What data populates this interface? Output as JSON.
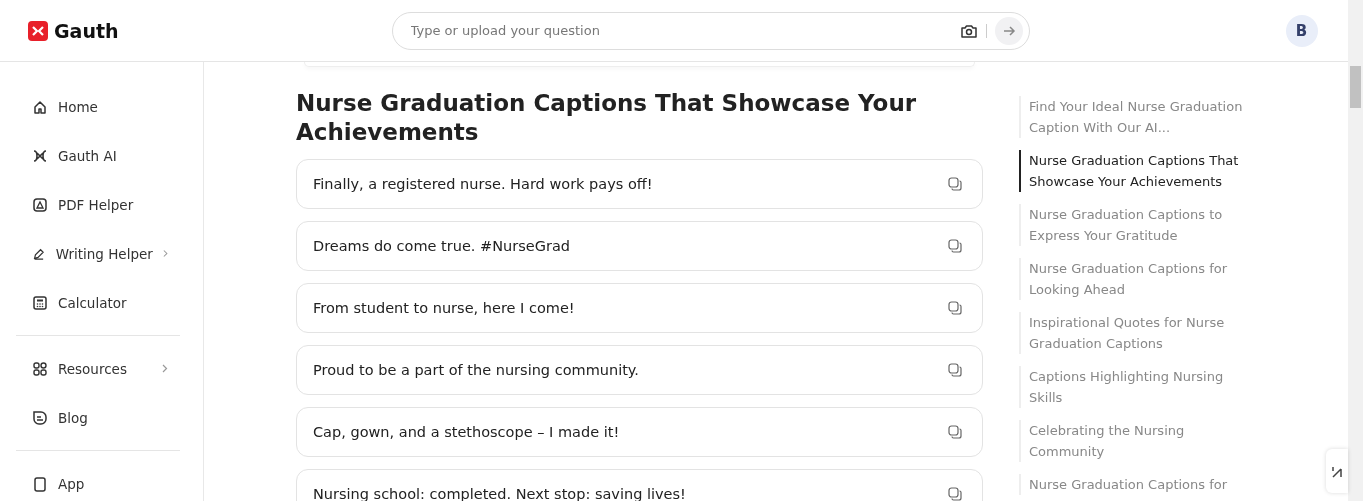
{
  "header": {
    "logo": "Gauth",
    "search": {
      "placeholder": "Type or upload your question"
    },
    "avatar": "B"
  },
  "sidebar": {
    "groups": [
      {
        "items": [
          {
            "label": "Home",
            "kind": "home",
            "submenu": false
          },
          {
            "label": "Gauth AI",
            "kind": "ai",
            "submenu": false
          },
          {
            "label": "PDF Helper",
            "kind": "pdf",
            "submenu": false
          },
          {
            "label": "Writing Helper",
            "kind": "pen",
            "submenu": true
          },
          {
            "label": "Calculator",
            "kind": "calc",
            "submenu": false
          }
        ]
      },
      {
        "items": [
          {
            "label": "Resources",
            "kind": "grid",
            "submenu": true
          },
          {
            "label": "Blog",
            "kind": "blog",
            "submenu": false
          }
        ]
      },
      {
        "items": [
          {
            "label": "App",
            "kind": "app",
            "submenu": false
          }
        ]
      }
    ]
  },
  "article": {
    "heading": "Nurse Graduation Captions That Showcase Your Achievements",
    "captions": [
      "Finally, a registered nurse. Hard work pays off!",
      "Dreams do come true. #NurseGrad",
      "From student to nurse, here I come!",
      "Proud to be a part of the nursing community.",
      "Cap, gown, and a stethoscope – I made it!",
      "Nursing school: completed. Next stop: saving lives!"
    ]
  },
  "toc": [
    {
      "label": "Find Your Ideal Nurse Graduation Caption With Our AI...",
      "selected": false
    },
    {
      "label": "Nurse Graduation Captions That Showcase Your Achievements",
      "selected": true
    },
    {
      "label": "Nurse Graduation Captions to Express Your Gratitude",
      "selected": false
    },
    {
      "label": "Nurse Graduation Captions for Looking Ahead",
      "selected": false
    },
    {
      "label": "Inspirational Quotes for Nurse Graduation Captions",
      "selected": false
    },
    {
      "label": "Captions Highlighting Nursing Skills",
      "selected": false
    },
    {
      "label": "Celebrating the Nursing Community",
      "selected": false
    },
    {
      "label": "Nurse Graduation Captions for",
      "selected": false
    }
  ]
}
